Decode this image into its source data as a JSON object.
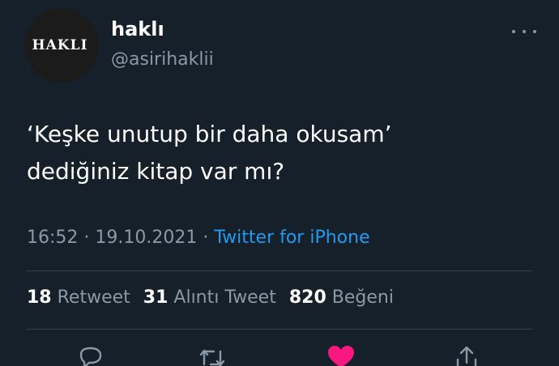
{
  "author": {
    "avatar_text": "HAKLI",
    "display_name": "haklı",
    "handle": "@asirihaklii"
  },
  "tweet": {
    "text": "‘Keşke unutup bir daha okusam’\ndediğiniz kitap var mı?",
    "time": "16:52",
    "date": "19.10.2021",
    "separator": "·",
    "source": "Twitter for iPhone"
  },
  "stats": {
    "retweets_count": "18",
    "retweets_label": "Retweet",
    "quotes_count": "31",
    "quotes_label": "Alıntı Tweet",
    "likes_count": "820",
    "likes_label": "Beğeni"
  },
  "actions": {
    "icons": [
      "reply-icon",
      "retweet-icon",
      "like-icon",
      "share-icon"
    ],
    "like_color": "#f91880",
    "icon_color": "#8b98a5"
  },
  "theme": {
    "background": "#15202b",
    "link_color": "#1d9bf0",
    "secondary_text": "#8b98a5"
  }
}
